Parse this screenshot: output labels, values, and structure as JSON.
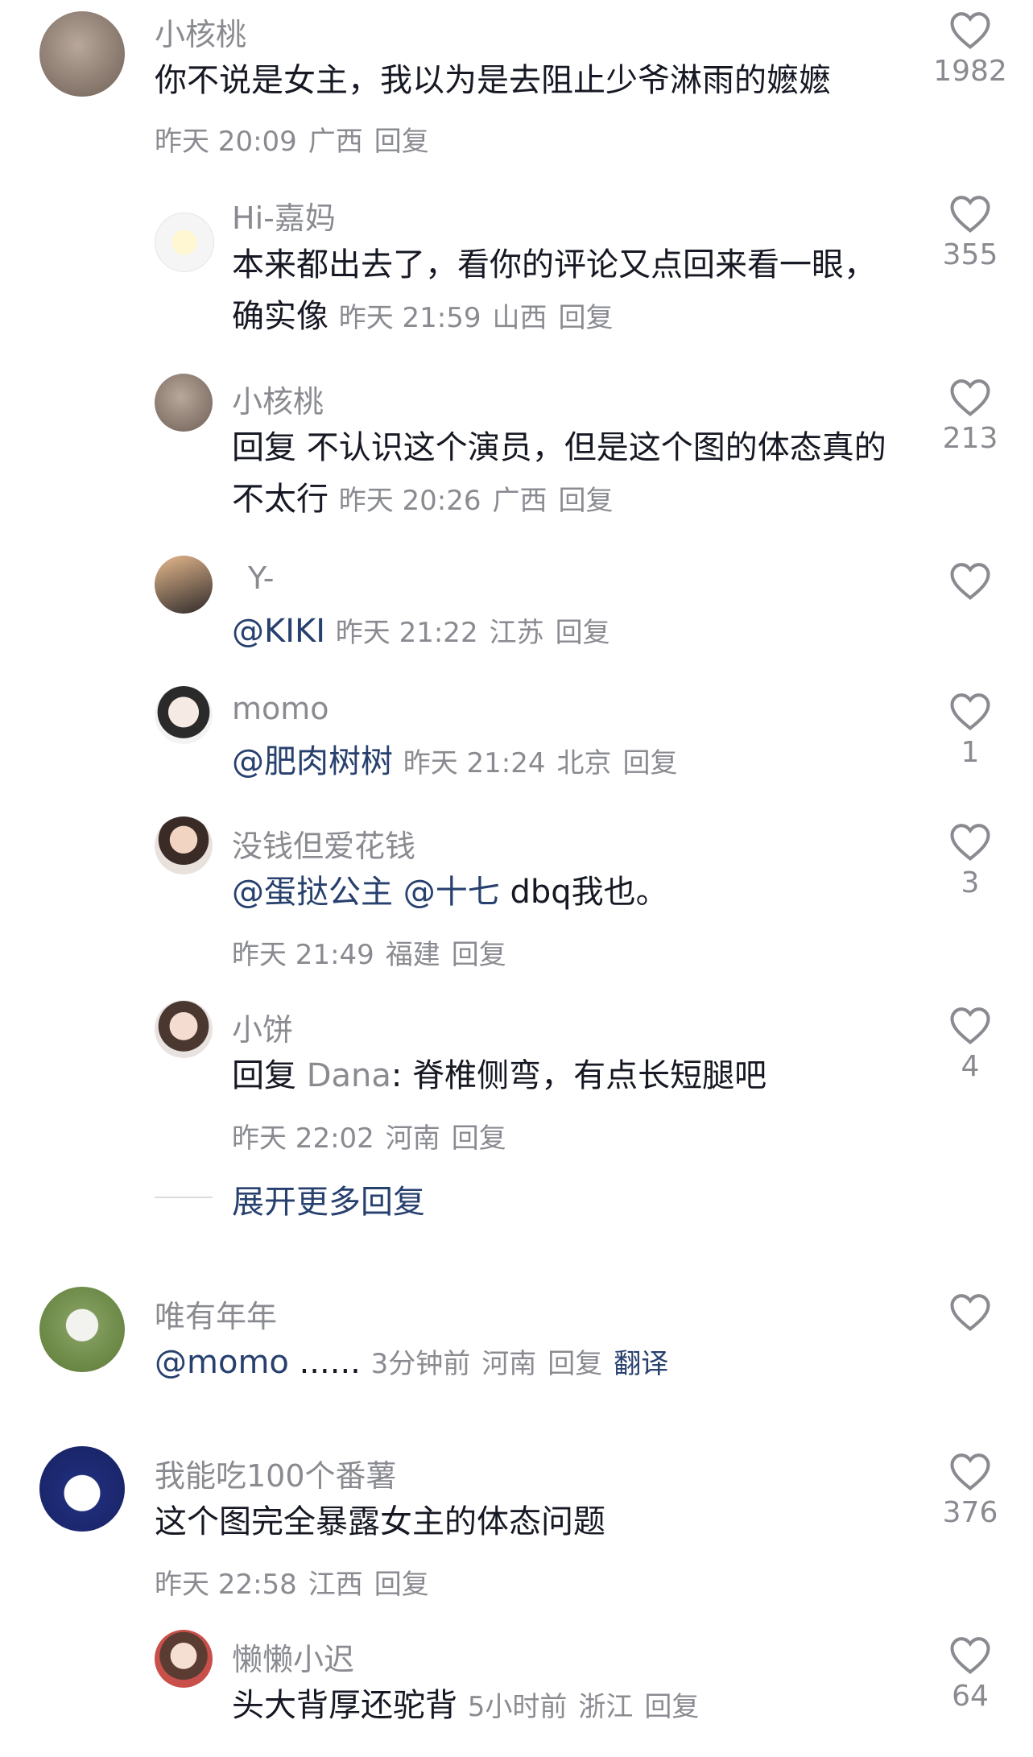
{
  "comments": [
    {
      "id": "c1",
      "avatar": "cat-meme-avatar",
      "name": "小核桃",
      "text": "你不说是女主，我以为是去阻止少爷淋雨的嬷嬷",
      "time": "昨天 20:09",
      "location": "广西",
      "reply": "回复",
      "likes": "1982"
    },
    {
      "id": "r1",
      "avatar": "sun-avatar",
      "name": "Hi-嘉妈",
      "text": "本来都出去了，看你的评论又点回来看一眼，确实像",
      "time": "昨天 21:59",
      "location": "山西",
      "reply": "回复",
      "likes": "355"
    },
    {
      "id": "r2",
      "avatar": "cat-meme-avatar",
      "name": "小核桃",
      "reply_prefix": "回复",
      "text": "不认识这个演员，但是这个图的体态真的不太行",
      "time": "昨天 20:26",
      "location": "广西",
      "reply": "回复",
      "likes": "213"
    },
    {
      "id": "r3",
      "avatar": "photo-avatar",
      "name": "Y-",
      "mention": "@KIKI",
      "time": "昨天 21:22",
      "location": "江苏",
      "reply": "回复",
      "likes": ""
    },
    {
      "id": "r4",
      "avatar": "girl-drawing-avatar",
      "name": "momo",
      "mention": "@肥肉树树",
      "time": "昨天 21:24",
      "location": "北京",
      "reply": "回复",
      "likes": "1"
    },
    {
      "id": "r5",
      "avatar": "girl-glasses-avatar",
      "name": "没钱但爱花钱",
      "mention1": "@蛋挞公主",
      "mention2": "@十七",
      "text": "dbq我也。",
      "time": "昨天 21:49",
      "location": "福建",
      "reply": "回复",
      "likes": "3"
    },
    {
      "id": "r6",
      "avatar": "girl-photo-avatar",
      "name": "小饼",
      "reply_prefix": "回复",
      "reply_to": "Dana",
      "text": ": 脊椎侧弯，有点长短腿吧",
      "time": "昨天 22:02",
      "location": "河南",
      "reply": "回复",
      "likes": "4"
    },
    {
      "id": "c2",
      "avatar": "grass-avatar",
      "name": "唯有年年",
      "mention": "@momo",
      "text": "......",
      "time": "3分钟前",
      "location": "河南",
      "reply": "回复",
      "translate": "翻译",
      "likes": ""
    },
    {
      "id": "c3",
      "avatar": "white-cat-avatar",
      "name": "我能吃100个番薯",
      "text": "这个图完全暴露女主的体态问题",
      "time": "昨天 22:58",
      "location": "江西",
      "reply": "回复",
      "likes": "376"
    },
    {
      "id": "r7",
      "avatar": "girl-red-avatar",
      "name": "懒懒小迟",
      "text": "头大背厚还驼背",
      "time": "5小时前",
      "location": "浙江",
      "reply": "回复",
      "likes": "64"
    }
  ],
  "expand_replies": "展开更多回复",
  "colors": {
    "link": "#27406e",
    "secondary": "#8a8b91",
    "text": "#161823"
  }
}
